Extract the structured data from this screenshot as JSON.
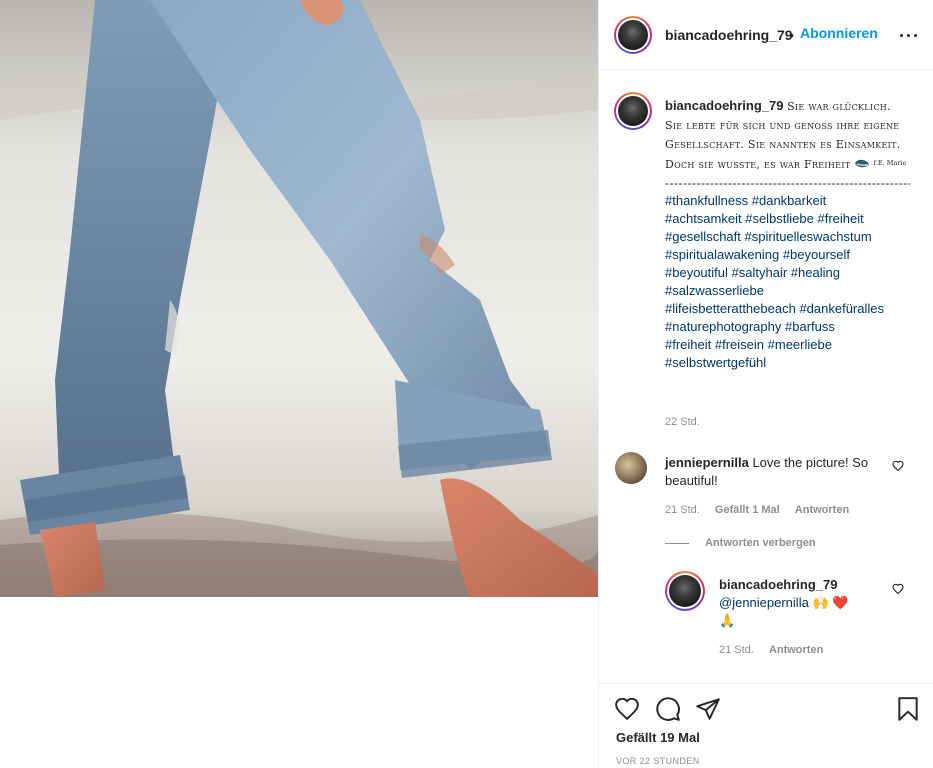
{
  "post": {
    "author": "biancadoehring_79",
    "separator": "•",
    "follow_label": "Abonnieren",
    "more_icon": "more-horizontal-icon"
  },
  "photo": {
    "subject": "jeans-walking-on-beach"
  },
  "caption": {
    "username": "biancadoehring_79",
    "text": "Sie war glücklich. Sie lebte für sich und genoss ihre eigene Gesellschaft. Sie nannten es Einsamkeit. Doch sie wusste, es war Freiheit",
    "attribution": "f.E. Marie",
    "divider": "------------------------------------------------------------------------------------------",
    "hashtags": [
      "#thankfullness",
      "#dankbarkeit",
      "#achtsamkeit",
      "#selbstliebe",
      "#freiheit",
      "#gesellschaft",
      "#spirituelleswachstum",
      "#spiritualawakening",
      "#beyourself",
      "#beyoutiful",
      "#saltyhair",
      "#healing",
      "#salzwasserliebe",
      "#lifeisbetteratthebeach",
      "#dankefüralles",
      "#naturephotography",
      "#barfuss",
      "#freiheit",
      "#freisein",
      "#meerliebe",
      "#selbstwertgefühl"
    ],
    "time": "22 Std."
  },
  "comments": [
    {
      "username": "jenniepernilla",
      "text": "Love the picture! So beautiful!",
      "time": "21 Std.",
      "likes": "Gefällt 1 Mal",
      "reply_label": "Antworten",
      "hide_replies_label": "Antworten verbergen",
      "replies": [
        {
          "username": "biancadoehring_79",
          "mention": "@jenniepernilla",
          "emoji": "🙌 ❤️",
          "emoji2": "🙏",
          "time": "21 Std.",
          "reply_label": "Antworten"
        }
      ]
    }
  ],
  "actions": {
    "likes": "Gefällt 19 Mal",
    "date": "VOR 22 STUNDEN"
  },
  "colors": {
    "accent": "#0095f6",
    "hashtag": "#00376b",
    "muted": "#8e8e8e",
    "text": "#262626",
    "heart": "#ed4956"
  }
}
